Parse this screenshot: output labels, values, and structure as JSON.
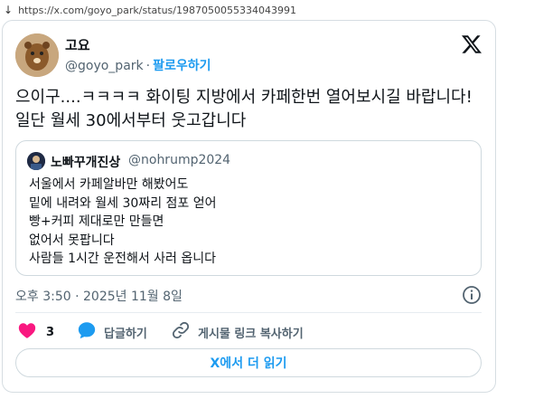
{
  "browser": {
    "url": "https://x.com/goyo_park/status/1987050055334043991"
  },
  "tweet": {
    "author_name": "고요",
    "author_handle": "@goyo_park",
    "separator": "·",
    "follow_label": "팔로우하기",
    "text": "으이구....ㅋㅋㅋㅋ 화이팅 지방에서 카페한번 열어보시길 바랍니다! 일단 월세 30에서부터 웃고갑니다",
    "timestamp": "오후 3:50 · 2025년 11월 8일"
  },
  "quote": {
    "author_name": "노빠꾸개진상",
    "author_handle": "@nohrump2024",
    "lines": [
      "서울에서 카페알바만 해봤어도",
      "밑에 내려와 월세 30짜리 점포 얻어",
      "빵+커피 제대로만 만들면",
      "없어서 못팝니다",
      "사람들 1시간 운전해서 사러 옵니다"
    ]
  },
  "actions": {
    "like_count": "3",
    "reply_label": "답글하기",
    "copy_link_label": "게시물 링크 복사하기"
  },
  "read_more_label": "X에서 더 읽기",
  "colors": {
    "accent": "#1d9bf0",
    "like": "#f91880",
    "muted": "#536471",
    "text": "#0f1419",
    "border": "#cfd9de"
  },
  "icons": {
    "download": "down-arrow-icon",
    "x_logo": "x-logo-icon",
    "info": "info-icon",
    "like": "heart-icon",
    "reply": "speech-bubble-icon",
    "link": "link-icon"
  }
}
